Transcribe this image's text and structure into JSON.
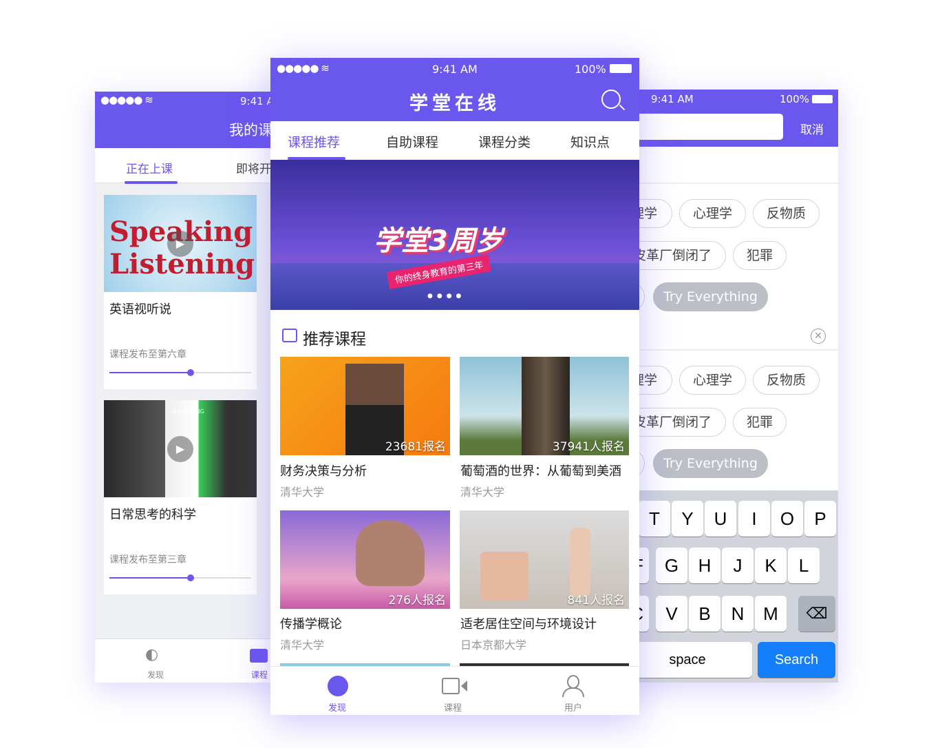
{
  "left": {
    "time": "9:41 A",
    "title": "我的课",
    "tabs": [
      "正在上课",
      "即将开"
    ],
    "cards": [
      {
        "image_text": "Speaking Listening",
        "title": "英语视听说",
        "progress_text": "课程发布至第六章",
        "progress": 0.57
      },
      {
        "image_text": "GROOMING",
        "title": "日常思考的科学",
        "progress_text": "课程发布至第三章",
        "progress": 0.57
      }
    ],
    "bottom": [
      {
        "label": "发现",
        "icon": "planet-icon"
      },
      {
        "label": "课程",
        "icon": "video-icon"
      }
    ]
  },
  "center": {
    "status": {
      "time": "9:41 AM",
      "battery": "100%"
    },
    "title": "学堂在线",
    "tabs": [
      "课程推荐",
      "自助课程",
      "课程分类",
      "知识点"
    ],
    "active_tab": 0,
    "banner": {
      "headline": "学堂3周岁",
      "sub": "你的终身教育的第三年"
    },
    "section_title": "推荐课程",
    "courses": [
      {
        "title": "财务决策与分析",
        "school": "清华大学",
        "enrolled": "23681报名"
      },
      {
        "title": "葡萄酒的世界：从葡萄到美酒",
        "school": "清华大学",
        "enrolled": "37941人报名"
      },
      {
        "title": "传播学概论",
        "school": "清华大学",
        "enrolled": "276人报名"
      },
      {
        "title": "适老居住空间与环境设计",
        "school": "日本京都大学",
        "enrolled": "841人报名"
      }
    ],
    "bottom": [
      {
        "label": "发现",
        "icon": "planet-icon"
      },
      {
        "label": "课程",
        "icon": "video-icon"
      },
      {
        "label": "用户",
        "icon": "user-icon"
      }
    ]
  },
  "right": {
    "status": {
      "time": "9:41 AM",
      "battery": "100%"
    },
    "cancel": "取消",
    "tags1": [
      "理学",
      "心理学",
      "反物质",
      "皮革厂倒闭了",
      "犯罪",
      "Try Everything"
    ],
    "tags2": [
      "理学",
      "心理学",
      "反物质",
      "皮革厂倒闭了",
      "犯罪",
      "Try Everything"
    ],
    "keyboard": {
      "row1": [
        "T",
        "Y",
        "U",
        "I",
        "O",
        "P"
      ],
      "row2": [
        "F",
        "G",
        "H",
        "J",
        "K",
        "L"
      ],
      "row3": [
        "C",
        "V",
        "B",
        "N",
        "M"
      ],
      "space": "space",
      "search": "Search"
    }
  },
  "colors": {
    "accent": "#6a57ee",
    "search_key": "#147efb"
  }
}
